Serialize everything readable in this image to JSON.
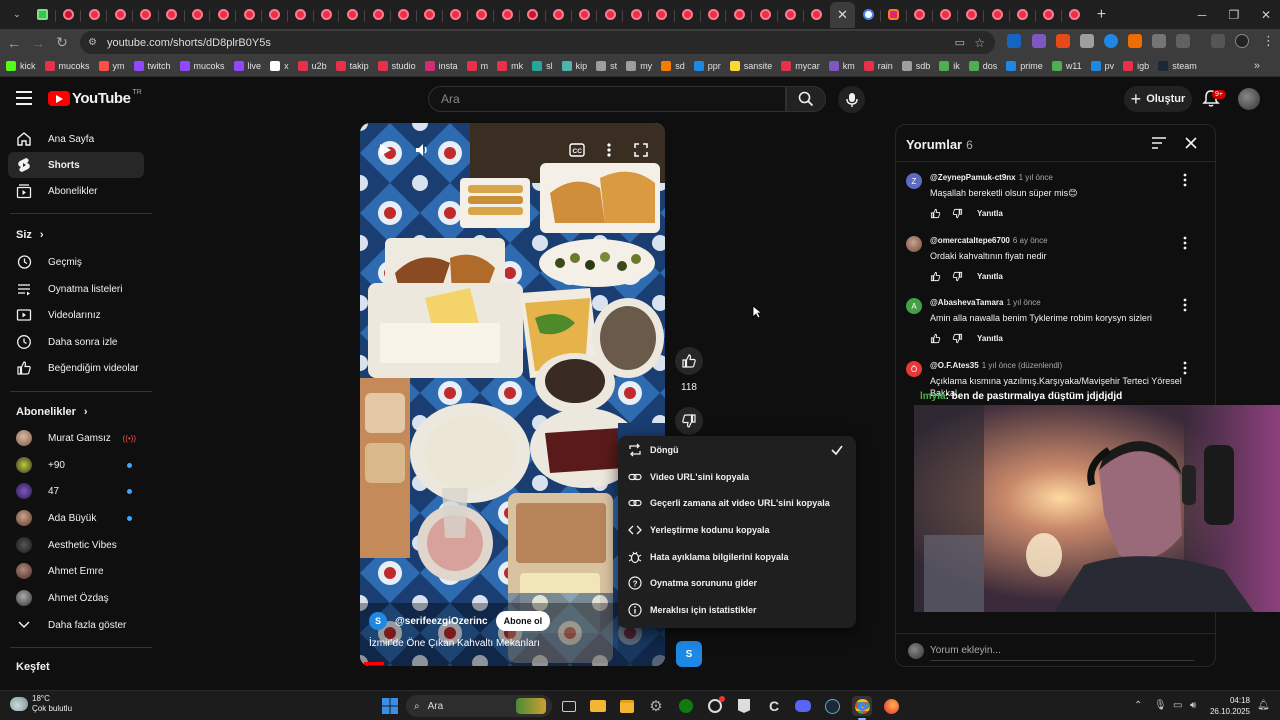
{
  "browser": {
    "url": "youtube.com/shorts/dD8plrB0Y5s",
    "bookmarks": [
      "kick",
      "mucoks",
      "ym",
      "twitch",
      "mucoks",
      "live",
      "x",
      "u2b",
      "takip",
      "studio",
      "insta",
      "m",
      "mk",
      "sl",
      "kip",
      "st",
      "my",
      "sd",
      "ppr",
      "sansite",
      "mycar",
      "km",
      "rain",
      "sdb",
      "ik",
      "dos",
      "prime",
      "w11",
      "pv",
      "igb",
      "steam"
    ]
  },
  "header": {
    "logo_text": "YouTube",
    "logo_region": "TR",
    "search_placeholder": "Ara",
    "create_label": "Oluştur",
    "notif_badge": "9+"
  },
  "sidebar": {
    "main": [
      {
        "label": "Ana Sayfa",
        "icon": "home-icon"
      },
      {
        "label": "Shorts",
        "icon": "shorts-icon"
      },
      {
        "label": "Abonelikler",
        "icon": "subscriptions-icon"
      }
    ],
    "you_title": "Siz",
    "you": [
      {
        "label": "Geçmiş",
        "icon": "history-icon"
      },
      {
        "label": "Oynatma listeleri",
        "icon": "playlist-icon"
      },
      {
        "label": "Videolarınız",
        "icon": "your-videos-icon"
      },
      {
        "label": "Daha sonra izle",
        "icon": "watch-later-icon"
      },
      {
        "label": "Beğendiğim videolar",
        "icon": "liked-icon"
      }
    ],
    "subs_title": "Abonelikler",
    "subs": [
      {
        "label": "Murat Gamsız",
        "badge": "live"
      },
      {
        "label": "+90",
        "badge": "dot"
      },
      {
        "label": "47",
        "badge": "dot"
      },
      {
        "label": "Ada Büyük",
        "badge": "dot"
      },
      {
        "label": "Aesthetic Vibes",
        "badge": ""
      },
      {
        "label": "Ahmet Emre",
        "badge": ""
      },
      {
        "label": "Ahmet Özdaş",
        "badge": ""
      }
    ],
    "show_more": "Daha fazla göster",
    "explore_title": "Keşfet"
  },
  "short": {
    "channel_handle": "@serifeezgiOzerinc",
    "channel_initial": "S",
    "subscribe_label": "Abone ol",
    "title": "İzmir'de Öne Çıkan Kahvaltı Mekanları",
    "likes": "118"
  },
  "context_menu": [
    {
      "label": "Döngü",
      "icon": "loop-icon",
      "checked": true
    },
    {
      "label": "Video URL'sini kopyala",
      "icon": "link-icon"
    },
    {
      "label": "Geçerli zamana ait video URL'sini kopyala",
      "icon": "link-icon"
    },
    {
      "label": "Yerleştirme kodunu kopyala",
      "icon": "embed-icon"
    },
    {
      "label": "Hata ayıklama bilgilerini kopyala",
      "icon": "bug-icon"
    },
    {
      "label": "Oynatma sorununu gider",
      "icon": "help-icon"
    },
    {
      "label": "Meraklısı için istatistikler",
      "icon": "info-icon"
    }
  ],
  "comments_panel": {
    "title": "Yorumlar",
    "count": "6",
    "reply_label": "Yanıtla",
    "input_placeholder": "Yorum ekleyin...",
    "items": [
      {
        "author": "@ZeynepPamuk-ct9nx",
        "time": "1 yıl önce",
        "text": "Maşallah bereketli olsun süper mis😊",
        "initial": "Z",
        "color": "#5c6bc0"
      },
      {
        "author": "@omercataltepe6700",
        "time": "6 ay önce",
        "text": "Ordaki kahvaltının fiyatı nedir",
        "initial": "",
        "color": "#8d6e63"
      },
      {
        "author": "@AbashevaTamara",
        "time": "1 yıl önce",
        "text": "Amin alla nawalla benim Tyklerime robim korysyn sizleri",
        "initial": "A",
        "color": "#43a047"
      },
      {
        "author": "@O.F.Ates35",
        "time": "1 yıl önce (düzenlendi)",
        "text": "Açıklama kısmına yazılmış.Karşıyaka/Mavişehir Terteci Yöresel Bakkal",
        "initial": "Ö",
        "color": "#e53935"
      }
    ]
  },
  "stream_overlay": {
    "user": "lmyia",
    "message": ": ben de pastırmalıya düştüm jdjdjdjd"
  },
  "taskbar": {
    "temp": "18°C",
    "weather": "Çok bulutlu",
    "search_label": "Ara",
    "time": "04:18",
    "date": "26.10.2025"
  }
}
